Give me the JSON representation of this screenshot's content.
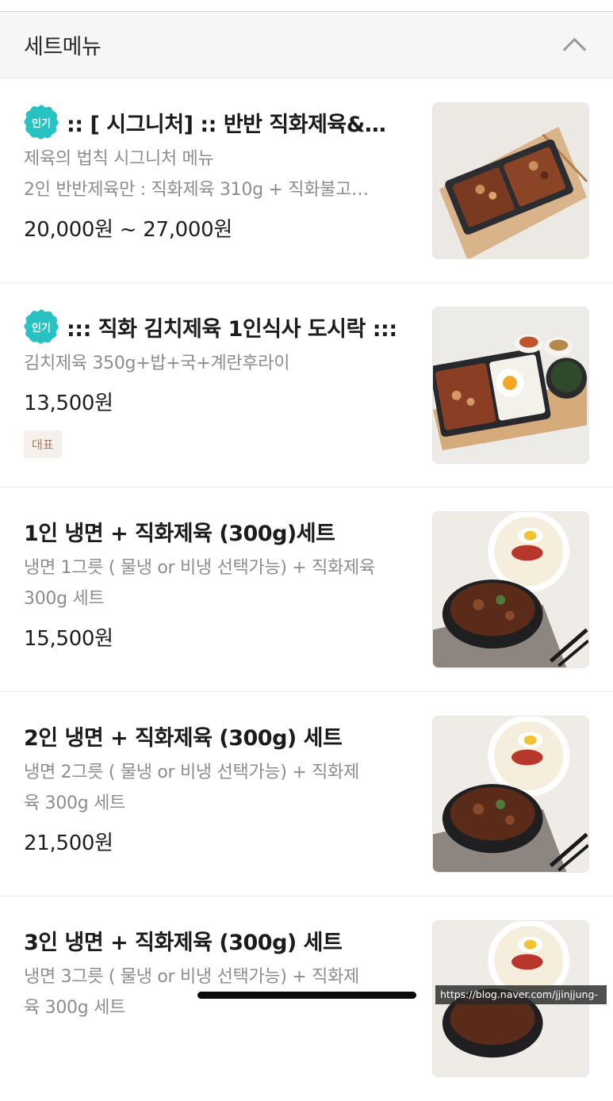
{
  "section": {
    "title": "세트메뉴",
    "collapse_icon": "chevron-up-icon"
  },
  "items": [
    {
      "badge": "인기",
      "name": ":: [ 시그니처] :: 반반 직화제육&…",
      "desc": [
        "제육의 법칙 시그니처 메뉴",
        "2인 반반제육만 : 직화제육 310g + 직화불고…"
      ],
      "price": "20,000원 ~ 27,000원",
      "tag": "",
      "image": "half-half-pork-box"
    },
    {
      "badge": "인기",
      "name": "::: 직화 김치제육 1인식사 도시락 :::",
      "desc": [
        "김치제육 350g+밥+국+계란후라이"
      ],
      "price": "13,500원",
      "tag": "대표",
      "image": "kimchi-pork-lunchbox"
    },
    {
      "badge": "",
      "name": "1인 냉면 + 직화제육 (300g)세트",
      "desc": [
        "냉면 1그릇 ( 물냉 or 비냉 선택가능) + 직화제육",
        "300g 세트"
      ],
      "price": "15,500원",
      "tag": "",
      "image": "naengmyeon-pork-set"
    },
    {
      "badge": "",
      "name": "2인 냉면 + 직화제육 (300g) 세트",
      "desc": [
        "냉면 2그릇 ( 물냉 or 비냉 선택가능) + 직화제",
        "육 300g 세트"
      ],
      "price": "21,500원",
      "tag": "",
      "image": "naengmyeon-pork-set"
    },
    {
      "badge": "",
      "name": "3인 냉면 + 직화제육 (300g) 세트",
      "desc": [
        "냉면 3그릇 ( 물냉 or 비냉 선택가능) + 직화제",
        "육 300g 세트"
      ],
      "price": "",
      "tag": "",
      "image": "naengmyeon-pork-set"
    }
  ],
  "watermark": "https://blog.naver.com/jjinjjung-"
}
